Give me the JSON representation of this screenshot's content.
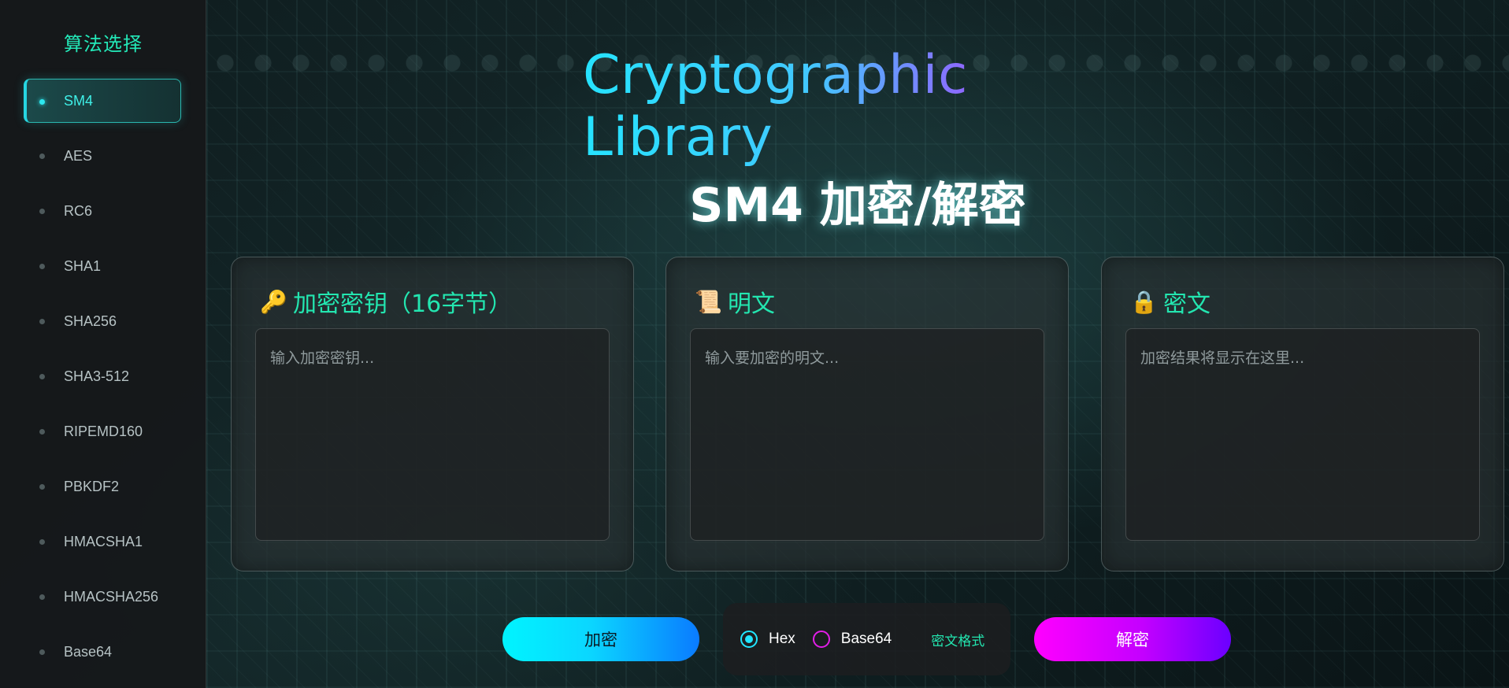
{
  "sidebar": {
    "title": "算法选择",
    "items": [
      {
        "label": "SM4",
        "active": true
      },
      {
        "label": "AES"
      },
      {
        "label": "RC6"
      },
      {
        "label": "SHA1"
      },
      {
        "label": "SHA256"
      },
      {
        "label": "SHA3-512"
      },
      {
        "label": "RIPEMD160"
      },
      {
        "label": "PBKDF2"
      },
      {
        "label": "HMACSHA1"
      },
      {
        "label": "HMACSHA256"
      },
      {
        "label": "Base64"
      }
    ]
  },
  "header": {
    "app_title": "Cryptographic Library",
    "page_title": "SM4 加密/解密"
  },
  "panels": {
    "key": {
      "icon": "key-icon",
      "title": "加密密钥（16字节）",
      "placeholder": "输入加密密钥..."
    },
    "plaintext": {
      "icon": "scroll-icon",
      "title": "明文",
      "placeholder": "输入要加密的明文..."
    },
    "ciphertext": {
      "icon": "lock-icon",
      "title": "密文",
      "placeholder": "加密结果将显示在这里..."
    }
  },
  "controls": {
    "encrypt_label": "加密",
    "decrypt_label": "解密",
    "format_options": [
      {
        "label": "Hex",
        "selected": true
      },
      {
        "label": "Base64",
        "selected": false
      }
    ],
    "format_label": "密文格式"
  },
  "colors": {
    "accent_green": "#23e6b0",
    "accent_cyan": "#21e6ff",
    "accent_magenta": "#e21ee8"
  }
}
